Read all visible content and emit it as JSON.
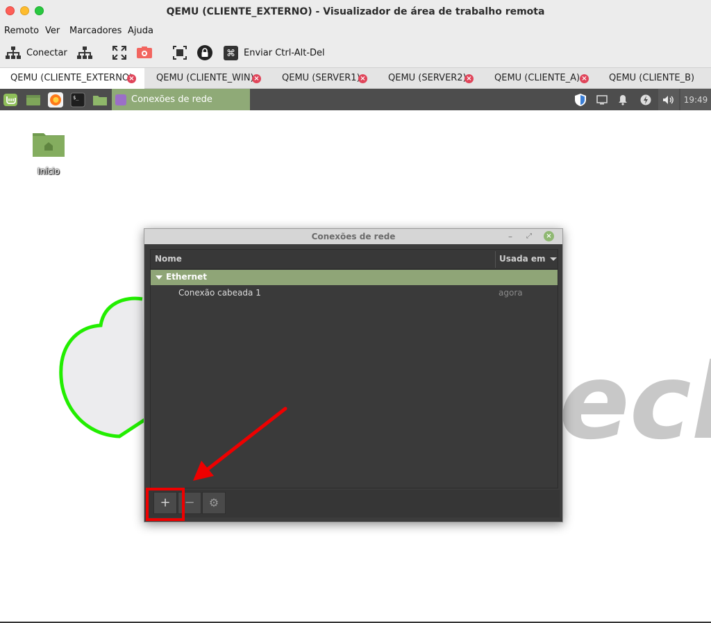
{
  "window": {
    "title": "QEMU (CLIENTE_EXTERNO) - Visualizador de área de trabalho remota"
  },
  "menu": {
    "items": [
      "Remoto",
      "Ver",
      "Marcadores",
      "Ajuda"
    ]
  },
  "toolbar": {
    "connect_label": "Conectar",
    "send_keys_label": "Enviar Ctrl-Alt-Del",
    "icons": [
      "network-icon",
      "network-alt-icon",
      "fullscreen-icon",
      "screenshot-icon",
      "scale-icon",
      "lock-icon",
      "command-key-icon"
    ]
  },
  "tabs": [
    {
      "label": "QEMU (CLIENTE_EXTERNO)",
      "active": true
    },
    {
      "label": "QEMU (CLIENTE_WIN)",
      "active": false
    },
    {
      "label": "QEMU (SERVER1)",
      "active": false
    },
    {
      "label": "QEMU (SERVER2)",
      "active": false
    },
    {
      "label": "QEMU (CLIENTE_A)",
      "active": false
    },
    {
      "label": "QEMU (CLIENTE_B)",
      "active": false
    }
  ],
  "panel": {
    "task_label": "Conexões de rede",
    "clock": "19:49"
  },
  "desktop": {
    "home_label": "Início",
    "wallpaper_text": "ech"
  },
  "dialog": {
    "title": "Conexões de rede",
    "col_name": "Nome",
    "col_used": "Usada em",
    "group_label": "Ethernet",
    "connection_name": "Conexão cabeada 1",
    "connection_used": "agora",
    "add_label": "+",
    "remove_label": "−",
    "settings_label": "⚙"
  },
  "colors": {
    "accent_green": "#8fa577",
    "annotation_red": "#ee0000",
    "wallpaper_green": "#22ee00"
  }
}
